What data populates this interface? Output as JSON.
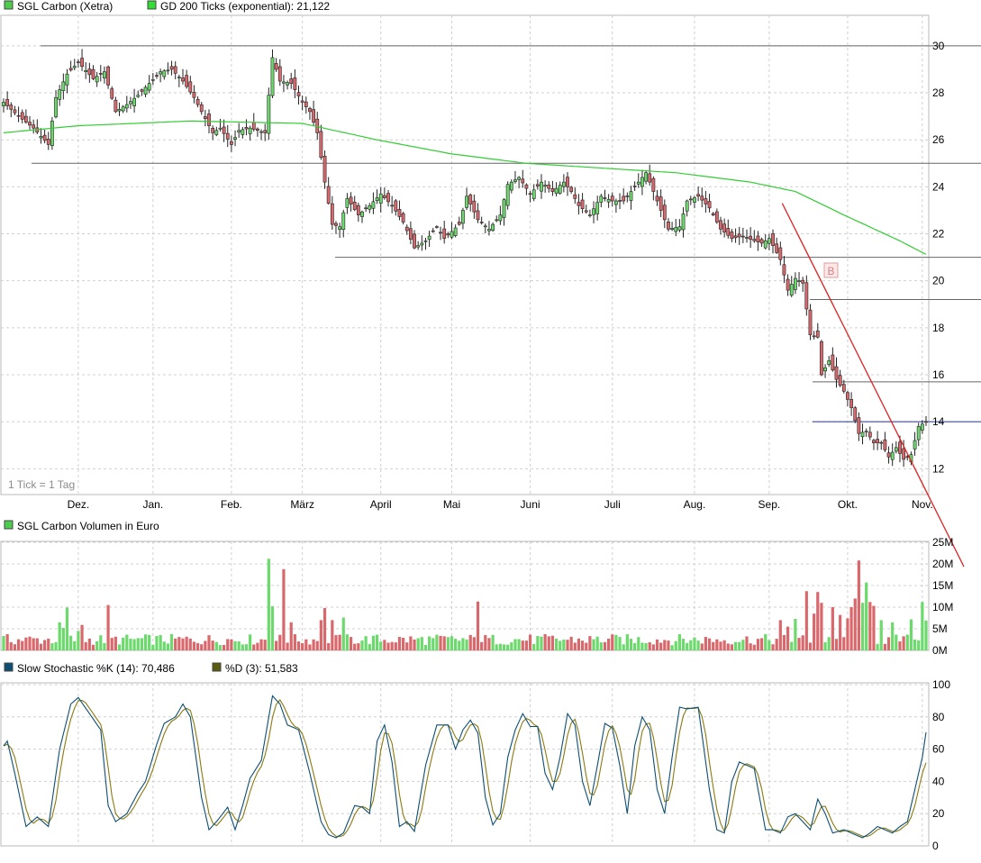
{
  "colors": {
    "up": "#6cd96c",
    "down": "#d9686c",
    "ma": "#33cc33",
    "trend": "#dd2222",
    "level": "#666666",
    "current": "#2233aa",
    "k": "#0d4f73",
    "d": "#8a7a10"
  },
  "price_panel": {
    "legend": [
      {
        "swatch": "#4dcc4d",
        "text": "SGL Carbon (Xetra)"
      },
      {
        "swatch": "#33dd33",
        "text": "GD 200 Ticks (exponential): 21,122"
      }
    ],
    "tick_note": "1 Tick = 1 Tag",
    "marker": "B",
    "y_ticks": [
      "12",
      "14",
      "16",
      "18",
      "20",
      "22",
      "24",
      "26",
      "28",
      "30"
    ],
    "months": [
      "Dez.",
      "Jan.",
      "Feb.",
      "März",
      "April",
      "Mai",
      "Juni",
      "Juli",
      "Aug.",
      "Sep.",
      "Okt.",
      "Nov."
    ]
  },
  "volume_panel": {
    "legend": [
      {
        "swatch": "#4dcc4d",
        "text": "SGL Carbon Volumen in Euro"
      }
    ],
    "y_ticks": [
      "0M",
      "5M",
      "10M",
      "15M",
      "20M",
      "25M"
    ]
  },
  "stoch_panel": {
    "legend": [
      {
        "swatch": "#0d4f73",
        "text": "Slow Stochastic %K (14): 70,486"
      },
      {
        "swatch": "#5a5a10",
        "text": "%D (3): 51,583"
      }
    ],
    "y_ticks": [
      "0",
      "20",
      "40",
      "60",
      "80",
      "100"
    ]
  },
  "chart_data": [
    {
      "type": "candlestick",
      "title": "SGL Carbon (Xetra)",
      "ylim": [
        10.9,
        31.3
      ],
      "x_months": [
        "Dez.",
        "Jan.",
        "Feb.",
        "März",
        "April",
        "Mai",
        "Juni",
        "Juli",
        "Aug.",
        "Sep.",
        "Okt.",
        "Nov."
      ],
      "series": [
        {
          "name": "SGL Carbon (Xetra)",
          "close_anchors": [
            [
              0,
              27.6
            ],
            [
              4,
              27.0
            ],
            [
              8,
              26.5
            ],
            [
              12,
              25.8
            ],
            [
              14,
              27.8
            ],
            [
              17,
              28.8
            ],
            [
              20,
              29.3
            ],
            [
              24,
              28.6
            ],
            [
              27,
              28.9
            ],
            [
              30,
              27.2
            ],
            [
              33,
              27.5
            ],
            [
              36,
              27.9
            ],
            [
              39,
              28.4
            ],
            [
              42,
              28.9
            ],
            [
              45,
              29.0
            ],
            [
              48,
              28.5
            ],
            [
              51,
              27.8
            ],
            [
              53,
              27.2
            ],
            [
              56,
              26.3
            ],
            [
              58,
              26.5
            ],
            [
              61,
              25.8
            ],
            [
              63,
              26.4
            ],
            [
              66,
              26.5
            ],
            [
              70,
              26.3
            ],
            [
              72,
              29.5
            ],
            [
              74,
              28.5
            ],
            [
              77,
              28.4
            ],
            [
              80,
              27.6
            ],
            [
              82,
              27.2
            ],
            [
              84,
              26.3
            ],
            [
              86,
              24.2
            ],
            [
              88,
              22.4
            ],
            [
              90,
              22.3
            ],
            [
              92,
              23.5
            ],
            [
              95,
              22.8
            ],
            [
              98,
              23.2
            ],
            [
              101,
              23.7
            ],
            [
              104,
              23.2
            ],
            [
              107,
              22.5
            ],
            [
              110,
              21.4
            ],
            [
              113,
              21.7
            ],
            [
              116,
              22.3
            ],
            [
              118,
              21.8
            ],
            [
              122,
              22.4
            ],
            [
              124,
              23.6
            ],
            [
              127,
              22.6
            ],
            [
              130,
              22.2
            ],
            [
              133,
              22.8
            ],
            [
              135,
              24.1
            ],
            [
              138,
              24.4
            ],
            [
              141,
              23.7
            ],
            [
              144,
              24.2
            ],
            [
              147,
              23.8
            ],
            [
              150,
              24.2
            ],
            [
              152,
              23.8
            ],
            [
              154,
              23.2
            ],
            [
              157,
              22.8
            ],
            [
              160,
              23.6
            ],
            [
              163,
              23.4
            ],
            [
              166,
              23.4
            ],
            [
              169,
              24.0
            ],
            [
              172,
              24.6
            ],
            [
              175,
              23.4
            ],
            [
              178,
              22.2
            ],
            [
              181,
              22.3
            ],
            [
              183,
              23.4
            ],
            [
              186,
              23.6
            ],
            [
              189,
              23.1
            ],
            [
              192,
              22.2
            ],
            [
              195,
              21.8
            ],
            [
              198,
              21.9
            ],
            [
              201,
              21.7
            ],
            [
              203,
              21.6
            ],
            [
              205,
              21.8
            ],
            [
              208,
              20.9
            ],
            [
              210,
              19.6
            ],
            [
              212,
              20.1
            ],
            [
              214,
              19.9
            ],
            [
              216,
              17.7
            ],
            [
              218,
              17.6
            ],
            [
              219,
              16.0
            ],
            [
              221,
              16.6
            ],
            [
              223,
              15.8
            ],
            [
              225,
              15.3
            ],
            [
              227,
              14.6
            ],
            [
              229,
              13.5
            ],
            [
              231,
              13.6
            ],
            [
              233,
              13.1
            ],
            [
              235,
              13.1
            ],
            [
              237,
              12.5
            ],
            [
              239,
              12.9
            ],
            [
              241,
              12.4
            ],
            [
              243,
              12.6
            ],
            [
              245,
              13.8
            ],
            [
              247,
              14.0
            ]
          ]
        },
        {
          "name": "GD 200 Ticks (exponential)",
          "value": 21.122,
          "anchors": [
            [
              0,
              26.3
            ],
            [
              20,
              26.6
            ],
            [
              50,
              26.8
            ],
            [
              80,
              26.7
            ],
            [
              100,
              26.0
            ],
            [
              120,
              25.4
            ],
            [
              140,
              25.0
            ],
            [
              160,
              24.8
            ],
            [
              180,
              24.6
            ],
            [
              200,
              24.2
            ],
            [
              212,
              23.8
            ],
            [
              225,
              22.8
            ],
            [
              240,
              21.7
            ],
            [
              247,
              21.122
            ]
          ]
        }
      ],
      "levels": [
        30.0,
        25.0,
        21.0,
        19.2,
        15.7
      ],
      "current_level": 14.0,
      "trend_line": [
        [
          208,
          23.3
        ],
        [
          247,
          10.9
        ]
      ],
      "last_bar": 247
    },
    {
      "type": "bar",
      "title": "SGL Carbon Volumen in Euro",
      "ylim": [
        0,
        25
      ],
      "unit": "M",
      "spikes": [
        [
          15,
          6.5
        ],
        [
          16,
          5.2
        ],
        [
          17,
          9.9
        ],
        [
          20,
          4.5
        ],
        [
          21,
          5.9
        ],
        [
          28,
          10.5
        ],
        [
          71,
          21.2
        ],
        [
          72,
          10.2
        ],
        [
          75,
          18.8
        ],
        [
          77,
          6.5
        ],
        [
          85,
          7.0
        ],
        [
          86,
          9.8
        ],
        [
          88,
          7.0
        ],
        [
          91,
          7.6
        ],
        [
          127,
          11.3
        ],
        [
          208,
          7.0
        ],
        [
          210,
          5.5
        ],
        [
          212,
          7.3
        ],
        [
          215,
          13.7
        ],
        [
          217,
          8.5
        ],
        [
          218,
          13.5
        ],
        [
          219,
          11.0
        ],
        [
          222,
          10.0
        ],
        [
          224,
          8.2
        ],
        [
          226,
          7.4
        ],
        [
          227,
          10.0
        ],
        [
          228,
          12.0
        ],
        [
          229,
          20.8
        ],
        [
          230,
          11.0
        ],
        [
          231,
          15.7
        ],
        [
          232,
          11.2
        ],
        [
          233,
          10.3
        ],
        [
          235,
          7.0
        ],
        [
          238,
          6.5
        ],
        [
          243,
          7.2
        ],
        [
          246,
          11.2
        ],
        [
          247,
          6.9
        ]
      ]
    },
    {
      "type": "line",
      "title": "Slow Stochastic",
      "ylim": [
        0,
        100
      ],
      "series": [
        {
          "name": "Slow Stochastic %K (14)",
          "value": 70.486,
          "anchors": [
            [
              0,
              62
            ],
            [
              1,
              65
            ],
            [
              3,
              45
            ],
            [
              6,
              12
            ],
            [
              9,
              18
            ],
            [
              12,
              12
            ],
            [
              15,
              60
            ],
            [
              18,
              88
            ],
            [
              20,
              92
            ],
            [
              23,
              82
            ],
            [
              26,
              72
            ],
            [
              28,
              25
            ],
            [
              30,
              15
            ],
            [
              33,
              20
            ],
            [
              36,
              33
            ],
            [
              38,
              40
            ],
            [
              41,
              63
            ],
            [
              43,
              76
            ],
            [
              46,
              80
            ],
            [
              48,
              88
            ],
            [
              50,
              80
            ],
            [
              53,
              30
            ],
            [
              55,
              10
            ],
            [
              57,
              15
            ],
            [
              60,
              24
            ],
            [
              62,
              10
            ],
            [
              64,
              25
            ],
            [
              66,
              42
            ],
            [
              69,
              53
            ],
            [
              72,
              93
            ],
            [
              74,
              88
            ],
            [
              76,
              75
            ],
            [
              79,
              72
            ],
            [
              82,
              45
            ],
            [
              85,
              15
            ],
            [
              87,
              7
            ],
            [
              89,
              5
            ],
            [
              91,
              8
            ],
            [
              94,
              25
            ],
            [
              96,
              24
            ],
            [
              98,
              20
            ],
            [
              100,
              65
            ],
            [
              102,
              75
            ],
            [
              104,
              52
            ],
            [
              106,
              12
            ],
            [
              108,
              15
            ],
            [
              110,
              9
            ],
            [
              113,
              50
            ],
            [
              116,
              75
            ],
            [
              119,
              75
            ],
            [
              121,
              60
            ],
            [
              123,
              72
            ],
            [
              125,
              78
            ],
            [
              127,
              70
            ],
            [
              129,
              30
            ],
            [
              131,
              13
            ],
            [
              133,
              20
            ],
            [
              135,
              55
            ],
            [
              137,
              72
            ],
            [
              139,
              82
            ],
            [
              141,
              74
            ],
            [
              143,
              74
            ],
            [
              145,
              45
            ],
            [
              147,
              35
            ],
            [
              149,
              55
            ],
            [
              151,
              82
            ],
            [
              153,
              75
            ],
            [
              155,
              40
            ],
            [
              157,
              25
            ],
            [
              159,
              50
            ],
            [
              161,
              76
            ],
            [
              163,
              73
            ],
            [
              165,
              50
            ],
            [
              167,
              20
            ],
            [
              169,
              62
            ],
            [
              171,
              80
            ],
            [
              173,
              72
            ],
            [
              175,
              35
            ],
            [
              177,
              20
            ],
            [
              179,
              55
            ],
            [
              181,
              86
            ],
            [
              183,
              85
            ],
            [
              186,
              86
            ],
            [
              189,
              35
            ],
            [
              191,
              10
            ],
            [
              193,
              8
            ],
            [
              195,
              40
            ],
            [
              197,
              52
            ],
            [
              199,
              50
            ],
            [
              201,
              48
            ],
            [
              204,
              10
            ],
            [
              206,
              10
            ],
            [
              208,
              8
            ],
            [
              210,
              18
            ],
            [
              212,
              20
            ],
            [
              214,
              15
            ],
            [
              216,
              10
            ],
            [
              218,
              29
            ],
            [
              220,
              20
            ],
            [
              222,
              8
            ],
            [
              225,
              10
            ],
            [
              227,
              8
            ],
            [
              230,
              5
            ],
            [
              232,
              8
            ],
            [
              234,
              12
            ],
            [
              236,
              10
            ],
            [
              238,
              8
            ],
            [
              240,
              12
            ],
            [
              242,
              15
            ],
            [
              244,
              35
            ],
            [
              246,
              55
            ],
            [
              247,
              70.486
            ]
          ]
        },
        {
          "name": "%D (3)",
          "value": 51.583,
          "lag": 1.6,
          "smooth": 0.5,
          "final": 51.583
        }
      ]
    }
  ]
}
